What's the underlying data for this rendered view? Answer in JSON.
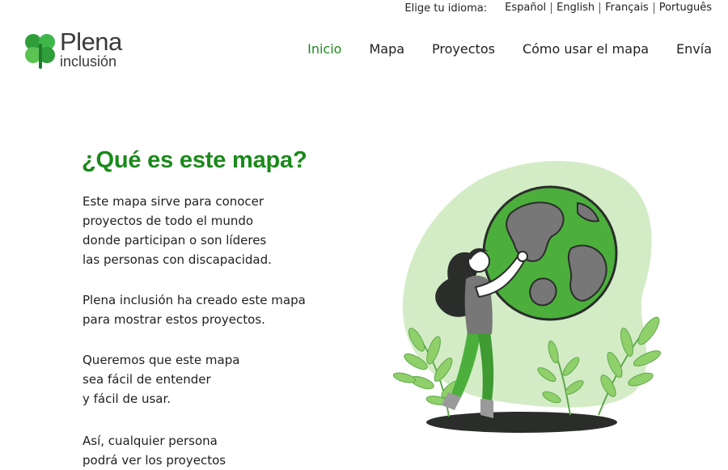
{
  "language_bar": {
    "label": "Elige tu idioma:",
    "languages": [
      "Español",
      "English",
      "Français",
      "Português"
    ]
  },
  "brand": {
    "name_line1": "Plena",
    "name_line2": "inclusión",
    "logo_green": "#2e9e3a",
    "text_color": "#3a3a3a"
  },
  "nav": {
    "items": [
      "Inicio",
      "Mapa",
      "Proyectos",
      "Cómo usar el mapa",
      "Envía"
    ],
    "active_index": 0,
    "active_color": "#1f8a1f"
  },
  "main": {
    "title": "¿Qué es este mapa?",
    "title_color": "#1a8a1a",
    "paragraphs": [
      [
        "Este mapa sirve para conocer",
        "proyectos de todo el mundo",
        "donde participan o son líderes",
        "las personas con discapacidad."
      ],
      [
        "Plena inclusión ha creado este mapa",
        "para mostrar estos proyectos."
      ],
      [
        "Queremos que este mapa",
        "sea fácil de entender",
        "y fácil de usar."
      ],
      [
        "Así, cualquier persona",
        "podrá ver los proyectos"
      ]
    ]
  },
  "illustration": {
    "subject": "woman-hugging-globe",
    "blob_color": "#d3ecc6",
    "globe_ocean": "#4caf3c",
    "globe_land": "#777777",
    "plant_color": "#8fd06a",
    "shadow_color": "#2a2d2a"
  }
}
